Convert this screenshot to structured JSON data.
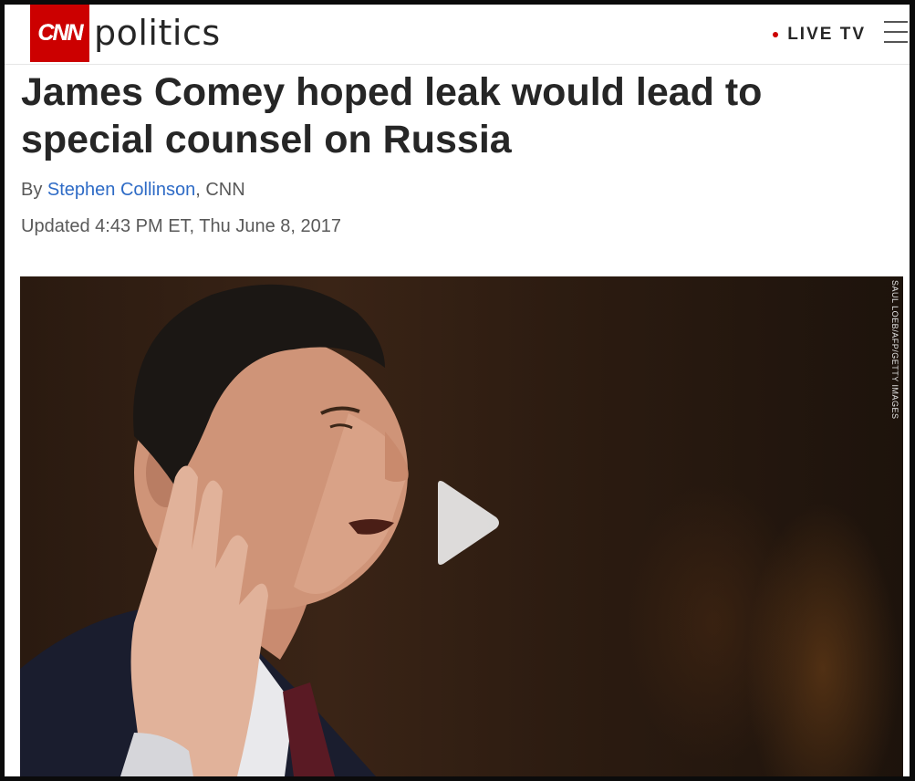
{
  "header": {
    "logo": "CNN",
    "section": "politics",
    "live_tv": "LIVE TV",
    "brand_color": "#cc0000"
  },
  "article": {
    "headline": "James Comey hoped leak would lead to special counsel on Russia",
    "byline_prefix": "By",
    "author": "Stephen Collinson",
    "byline_suffix": ", CNN",
    "updated": "Updated 4:43 PM ET, Thu June 8, 2017"
  },
  "video": {
    "photo_credit": "SAUL LOEB/AFP/GETTY IMAGES",
    "play_icon": "play-icon"
  },
  "icons": {
    "menu": "hamburger-menu-icon",
    "live": "live-dot-icon"
  }
}
